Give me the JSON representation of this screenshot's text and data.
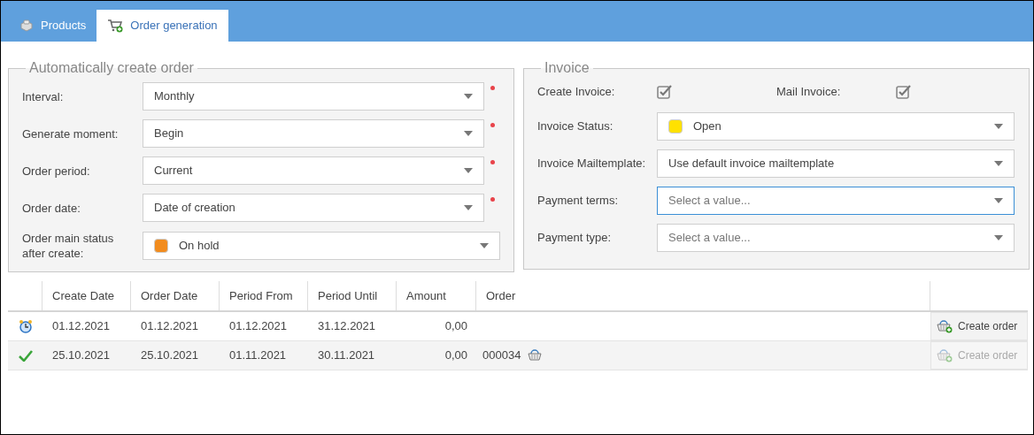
{
  "tabs": [
    {
      "label": "Products",
      "kind": "products",
      "selected": false
    },
    {
      "label": "Order generation",
      "kind": "ordergen",
      "selected": true
    }
  ],
  "auto_order": {
    "title": "Automatically create order",
    "fields": [
      {
        "label": "Interval:",
        "value": "Monthly",
        "required": true
      },
      {
        "label": "Generate moment:",
        "value": "Begin",
        "required": true
      },
      {
        "label": "Order period:",
        "value": "Current",
        "required": true
      },
      {
        "label": "Order date:",
        "value": "Date of creation",
        "required": true
      },
      {
        "label": "Order main status after create:",
        "value": "On hold",
        "required": false,
        "color": "#f28c1e"
      }
    ]
  },
  "invoice": {
    "title": "Invoice",
    "checkboxes": [
      {
        "label": "Create Invoice:",
        "checked": true
      },
      {
        "label": "Mail Invoice:",
        "checked": true
      }
    ],
    "fields": [
      {
        "label": "Invoice Status:",
        "value": "Open",
        "color": "#ffe100",
        "focused": false
      },
      {
        "label": "Invoice Mailtemplate:",
        "value": "Use default invoice mailtemplate",
        "focused": false
      },
      {
        "label": "Payment terms:",
        "placeholder": "Select a value...",
        "focused": true
      },
      {
        "label": "Payment type:",
        "placeholder": "Select a value...",
        "focused": false
      }
    ]
  },
  "table": {
    "columns": [
      "Create Date",
      "Order Date",
      "Period From",
      "Period Until",
      "Amount",
      "Order"
    ],
    "rows": [
      {
        "kind": "scheduled",
        "cells": [
          "01.12.2021",
          "01.12.2021",
          "01.12.2021",
          "31.12.2021",
          "0,00"
        ],
        "action": {
          "label": "Create order",
          "disabled": false
        }
      },
      {
        "kind": "done",
        "cells": [
          "25.10.2021",
          "25.10.2021",
          "01.11.2021",
          "30.11.2021",
          "0,00"
        ],
        "order": "000034",
        "action": {
          "label": "Create order",
          "disabled": true
        }
      }
    ]
  }
}
